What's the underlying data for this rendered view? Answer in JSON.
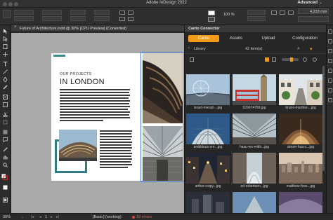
{
  "app": {
    "title": "Adobe InDesign 2022",
    "workspace": "Advanced"
  },
  "control_bar": {
    "stroke_weight": "4,233 mm",
    "zoom_percent": "100 %"
  },
  "document": {
    "tab_label": "Future of Architecture.indd @ 30% [CPU Preview] (Converted)",
    "small_title": "OUR PROJECTS",
    "big_title": "IN LONDON"
  },
  "status_bar": {
    "zoom": "30%",
    "page_number": "1",
    "style": "[Basic] (working)",
    "errors": "18 errors"
  },
  "canto": {
    "header": "Canto Connector",
    "tabs": [
      {
        "label": "Canto",
        "active": true
      },
      {
        "label": "Assets",
        "active": false
      },
      {
        "label": "Upload",
        "active": false
      },
      {
        "label": "Configuration",
        "active": false
      }
    ],
    "location": "Library",
    "item_count": "42 item(s)",
    "accent_color": "#f39a1b",
    "thumbnails": [
      {
        "caption": "israel-merad-...jpg",
        "scene": "bridge"
      },
      {
        "caption": "629074758.jpg",
        "scene": "bigben-bus"
      },
      {
        "caption": "bruno-martins-...jpg",
        "scene": "street-houses"
      },
      {
        "caption": "ambitious-cre...jpg",
        "scene": "glass-dome"
      },
      {
        "caption": "hasu-wo-mitih...jpg",
        "scene": "station-roof"
      },
      {
        "caption": "simon-hua-c...jpg",
        "scene": "market-hall"
      },
      {
        "caption": "arthur-osipy...jpg",
        "scene": "night-street"
      },
      {
        "caption": "ed-robertson...jpg",
        "scene": "arches"
      },
      {
        "caption": "matthew-foss...jpg",
        "scene": "city-skyline"
      },
      {
        "caption": "",
        "scene": "dark-city"
      },
      {
        "caption": "",
        "scene": "blue-sky"
      },
      {
        "caption": "",
        "scene": "purple-roof"
      }
    ]
  }
}
